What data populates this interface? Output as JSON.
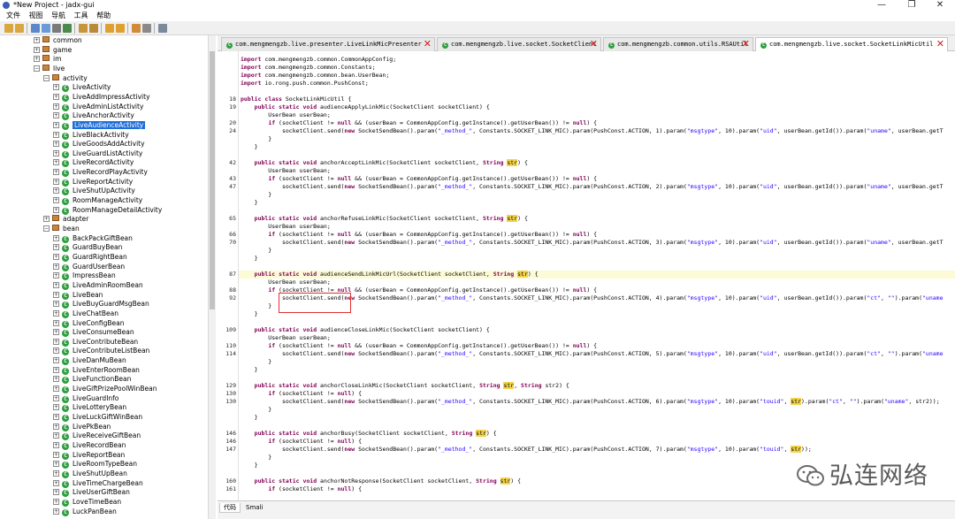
{
  "window": {
    "title": "*New Project - jadx-gui",
    "minimize": "—",
    "maximize": "❐",
    "close": "✕"
  },
  "menu": [
    "文件",
    "视图",
    "导航",
    "工具",
    "帮助"
  ],
  "tree": {
    "nodes": [
      {
        "label": "common",
        "kind": "pkg",
        "indent": 1,
        "toggle": "+"
      },
      {
        "label": "game",
        "kind": "pkg",
        "indent": 1,
        "toggle": "+"
      },
      {
        "label": "im",
        "kind": "pkg",
        "indent": 1,
        "toggle": "+"
      },
      {
        "label": "live",
        "kind": "pkg",
        "indent": 1,
        "toggle": "−"
      },
      {
        "label": "activity",
        "kind": "pkg",
        "indent": 2,
        "toggle": "−"
      },
      {
        "label": "LiveActivity",
        "kind": "cls",
        "indent": 3,
        "toggle": "+"
      },
      {
        "label": "LiveAddImpressActivity",
        "kind": "cls",
        "indent": 3,
        "toggle": "+"
      },
      {
        "label": "LiveAdminListActivity",
        "kind": "cls",
        "indent": 3,
        "toggle": "+"
      },
      {
        "label": "LiveAnchorActivity",
        "kind": "cls",
        "indent": 3,
        "toggle": "+"
      },
      {
        "label": "LiveAudienceActivity",
        "kind": "cls",
        "indent": 3,
        "toggle": "+",
        "selected": true
      },
      {
        "label": "LiveBlackActivity",
        "kind": "cls",
        "indent": 3,
        "toggle": "+"
      },
      {
        "label": "LiveGoodsAddActivity",
        "kind": "cls",
        "indent": 3,
        "toggle": "+"
      },
      {
        "label": "LiveGuardListActivity",
        "kind": "cls",
        "indent": 3,
        "toggle": "+"
      },
      {
        "label": "LiveRecordActivity",
        "kind": "cls",
        "indent": 3,
        "toggle": "+"
      },
      {
        "label": "LiveRecordPlayActivity",
        "kind": "cls",
        "indent": 3,
        "toggle": "+"
      },
      {
        "label": "LiveReportActivity",
        "kind": "cls",
        "indent": 3,
        "toggle": "+"
      },
      {
        "label": "LiveShutUpActivity",
        "kind": "cls",
        "indent": 3,
        "toggle": "+"
      },
      {
        "label": "RoomManageActivity",
        "kind": "cls",
        "indent": 3,
        "toggle": "+"
      },
      {
        "label": "RoomManageDetailActivity",
        "kind": "cls",
        "indent": 3,
        "toggle": "+"
      },
      {
        "label": "adapter",
        "kind": "pkg",
        "indent": 2,
        "toggle": "+"
      },
      {
        "label": "bean",
        "kind": "pkg",
        "indent": 2,
        "toggle": "−"
      },
      {
        "label": "BackPackGiftBean",
        "kind": "cls",
        "indent": 3,
        "toggle": "+"
      },
      {
        "label": "GuardBuyBean",
        "kind": "cls",
        "indent": 3,
        "toggle": "+"
      },
      {
        "label": "GuardRightBean",
        "kind": "cls",
        "indent": 3,
        "toggle": "+"
      },
      {
        "label": "GuardUserBean",
        "kind": "cls",
        "indent": 3,
        "toggle": "+"
      },
      {
        "label": "ImpressBean",
        "kind": "cls",
        "indent": 3,
        "toggle": "+"
      },
      {
        "label": "LiveAdminRoomBean",
        "kind": "cls",
        "indent": 3,
        "toggle": "+"
      },
      {
        "label": "LiveBean",
        "kind": "cls",
        "indent": 3,
        "toggle": "+"
      },
      {
        "label": "LiveBuyGuardMsgBean",
        "kind": "cls",
        "indent": 3,
        "toggle": "+"
      },
      {
        "label": "LiveChatBean",
        "kind": "cls",
        "indent": 3,
        "toggle": "+"
      },
      {
        "label": "LiveConfigBean",
        "kind": "cls",
        "indent": 3,
        "toggle": "+"
      },
      {
        "label": "LiveConsumeBean",
        "kind": "cls",
        "indent": 3,
        "toggle": "+"
      },
      {
        "label": "LiveContributeBean",
        "kind": "cls",
        "indent": 3,
        "toggle": "+"
      },
      {
        "label": "LiveContributeListBean",
        "kind": "cls",
        "indent": 3,
        "toggle": "+"
      },
      {
        "label": "LiveDanMuBean",
        "kind": "cls",
        "indent": 3,
        "toggle": "+"
      },
      {
        "label": "LiveEnterRoomBean",
        "kind": "cls",
        "indent": 3,
        "toggle": "+"
      },
      {
        "label": "LiveFunctionBean",
        "kind": "cls",
        "indent": 3,
        "toggle": "+"
      },
      {
        "label": "LiveGiftPrizePoolWinBean",
        "kind": "cls",
        "indent": 3,
        "toggle": "+"
      },
      {
        "label": "LiveGuardInfo",
        "kind": "cls",
        "indent": 3,
        "toggle": "+"
      },
      {
        "label": "LiveLotteryBean",
        "kind": "cls",
        "indent": 3,
        "toggle": "+"
      },
      {
        "label": "LiveLuckGiftWinBean",
        "kind": "cls",
        "indent": 3,
        "toggle": "+"
      },
      {
        "label": "LivePkBean",
        "kind": "cls",
        "indent": 3,
        "toggle": "+"
      },
      {
        "label": "LiveReceiveGiftBean",
        "kind": "cls",
        "indent": 3,
        "toggle": "+"
      },
      {
        "label": "LiveRecordBean",
        "kind": "cls",
        "indent": 3,
        "toggle": "+"
      },
      {
        "label": "LiveReportBean",
        "kind": "cls",
        "indent": 3,
        "toggle": "+"
      },
      {
        "label": "LiveRoomTypeBean",
        "kind": "cls",
        "indent": 3,
        "toggle": "+"
      },
      {
        "label": "LiveShutUpBean",
        "kind": "cls",
        "indent": 3,
        "toggle": "+"
      },
      {
        "label": "LiveTimeChargeBean",
        "kind": "cls",
        "indent": 3,
        "toggle": "+"
      },
      {
        "label": "LiveUserGiftBean",
        "kind": "cls",
        "indent": 3,
        "toggle": "+"
      },
      {
        "label": "LoveTimeBean",
        "kind": "cls",
        "indent": 3,
        "toggle": "+"
      },
      {
        "label": "LuckPanBean",
        "kind": "cls",
        "indent": 3,
        "toggle": "+"
      }
    ]
  },
  "tabs": [
    {
      "label": "com.mengmengzb.live.presenter.LiveLinkMicPresenter",
      "active": false
    },
    {
      "label": "com.mengmengzb.live.socket.SocketClient",
      "active": false
    },
    {
      "label": "com.mengmengzb.common.utils.RSAUtil",
      "active": false
    },
    {
      "label": "com.mengmengzb.live.socket.SocketLinkMicUtil",
      "active": true
    }
  ],
  "code": {
    "lines": [
      {
        "n": "",
        "t": "import com.mengmengzb.common.CommonAppConfig;"
      },
      {
        "n": "",
        "t": "import com.mengmengzb.common.Constants;"
      },
      {
        "n": "",
        "t": "import com.mengmengzb.common.bean.UserBean;"
      },
      {
        "n": "",
        "t": "import io.rong.push.common.PushConst;"
      },
      {
        "n": "",
        "t": ""
      },
      {
        "n": "18",
        "t": "public class SocketLinkMicUtil {"
      },
      {
        "n": "19",
        "t": "    public static void audienceApplyLinkMic(SocketClient socketClient) {"
      },
      {
        "n": "",
        "t": "        UserBean userBean;"
      },
      {
        "n": "20",
        "t": "        if (socketClient != null && (userBean = CommonAppConfig.getInstance().getUserBean()) != null) {"
      },
      {
        "n": "24",
        "t": "            socketClient.send(new SocketSendBean().param(\"_method_\", Constants.SOCKET_LINK_MIC).param(PushConst.ACTION, 1).param(\"msgtype\", 10).param(\"uid\", userBean.getId()).param(\"uname\", userBean.getT"
      },
      {
        "n": "",
        "t": "        }"
      },
      {
        "n": "",
        "t": "    }"
      },
      {
        "n": "",
        "t": ""
      },
      {
        "n": "42",
        "t": "    public static void anchorAcceptLinkMic(SocketClient socketClient, String str) {"
      },
      {
        "n": "",
        "t": "        UserBean userBean;"
      },
      {
        "n": "43",
        "t": "        if (socketClient != null && (userBean = CommonAppConfig.getInstance().getUserBean()) != null) {"
      },
      {
        "n": "47",
        "t": "            socketClient.send(new SocketSendBean().param(\"_method_\", Constants.SOCKET_LINK_MIC).param(PushConst.ACTION, 2).param(\"msgtype\", 10).param(\"uid\", userBean.getId()).param(\"uname\", userBean.getT"
      },
      {
        "n": "",
        "t": "        }"
      },
      {
        "n": "",
        "t": "    }"
      },
      {
        "n": "",
        "t": ""
      },
      {
        "n": "65",
        "t": "    public static void anchorRefuseLinkMic(SocketClient socketClient, String str) {"
      },
      {
        "n": "",
        "t": "        UserBean userBean;"
      },
      {
        "n": "66",
        "t": "        if (socketClient != null && (userBean = CommonAppConfig.getInstance().getUserBean()) != null) {"
      },
      {
        "n": "70",
        "t": "            socketClient.send(new SocketSendBean().param(\"_method_\", Constants.SOCKET_LINK_MIC).param(PushConst.ACTION, 3).param(\"msgtype\", 10).param(\"uid\", userBean.getId()).param(\"uname\", userBean.getT"
      },
      {
        "n": "",
        "t": "        }"
      },
      {
        "n": "",
        "t": "    }"
      },
      {
        "n": "",
        "t": ""
      },
      {
        "n": "87",
        "t": "    public static void audienceSendLinkMicUrl(SocketClient socketClient, String str) {",
        "highlight": true
      },
      {
        "n": "",
        "t": "        UserBean userBean;"
      },
      {
        "n": "88",
        "t": "        if (socketClient != null && (userBean = CommonAppConfig.getInstance().getUserBean()) != null) {"
      },
      {
        "n": "92",
        "t": "            socketClient.send(new SocketSendBean().param(\"_method_\", Constants.SOCKET_LINK_MIC).param(PushConst.ACTION, 4).param(\"msgtype\", 10).param(\"uid\", userBean.getId()).param(\"ct\", \"\").param(\"uname"
      },
      {
        "n": "",
        "t": "        }"
      },
      {
        "n": "",
        "t": "    }"
      },
      {
        "n": "",
        "t": ""
      },
      {
        "n": "109",
        "t": "    public static void audienceCloseLinkMic(SocketClient socketClient) {"
      },
      {
        "n": "",
        "t": "        UserBean userBean;"
      },
      {
        "n": "110",
        "t": "        if (socketClient != null && (userBean = CommonAppConfig.getInstance().getUserBean()) != null) {"
      },
      {
        "n": "114",
        "t": "            socketClient.send(new SocketSendBean().param(\"_method_\", Constants.SOCKET_LINK_MIC).param(PushConst.ACTION, 5).param(\"msgtype\", 10).param(\"uid\", userBean.getId()).param(\"ct\", \"\").param(\"uname"
      },
      {
        "n": "",
        "t": "        }"
      },
      {
        "n": "",
        "t": "    }"
      },
      {
        "n": "",
        "t": ""
      },
      {
        "n": "129",
        "t": "    public static void anchorCloseLinkMic(SocketClient socketClient, String str, String str2) {"
      },
      {
        "n": "130",
        "t": "        if (socketClient != null) {"
      },
      {
        "n": "130",
        "t": "            socketClient.send(new SocketSendBean().param(\"_method_\", Constants.SOCKET_LINK_MIC).param(PushConst.ACTION, 6).param(\"msgtype\", 10).param(\"touid\", str).param(\"ct\", \"\").param(\"uname\", str2));"
      },
      {
        "n": "",
        "t": "        }"
      },
      {
        "n": "",
        "t": "    }"
      },
      {
        "n": "",
        "t": ""
      },
      {
        "n": "146",
        "t": "    public static void anchorBusy(SocketClient socketClient, String str) {"
      },
      {
        "n": "146",
        "t": "        if (socketClient != null) {"
      },
      {
        "n": "147",
        "t": "            socketClient.send(new SocketSendBean().param(\"_method_\", Constants.SOCKET_LINK_MIC).param(PushConst.ACTION, 7).param(\"msgtype\", 10).param(\"touid\", str));"
      },
      {
        "n": "",
        "t": "        }"
      },
      {
        "n": "",
        "t": "    }"
      },
      {
        "n": "",
        "t": ""
      },
      {
        "n": "160",
        "t": "    public static void anchorNotResponse(SocketClient socketClient, String str) {"
      },
      {
        "n": "161",
        "t": "        if (socketClient != null) {"
      }
    ]
  },
  "bottom_tabs": [
    "代码",
    "Smali"
  ],
  "watermark": {
    "text": "弘连网络"
  },
  "colors": {
    "selection": "#1f6fd8",
    "keyword": "#7f0055",
    "string": "#2a00ff",
    "str_highlight": "#f3d34b",
    "red_box": "#e03030"
  }
}
